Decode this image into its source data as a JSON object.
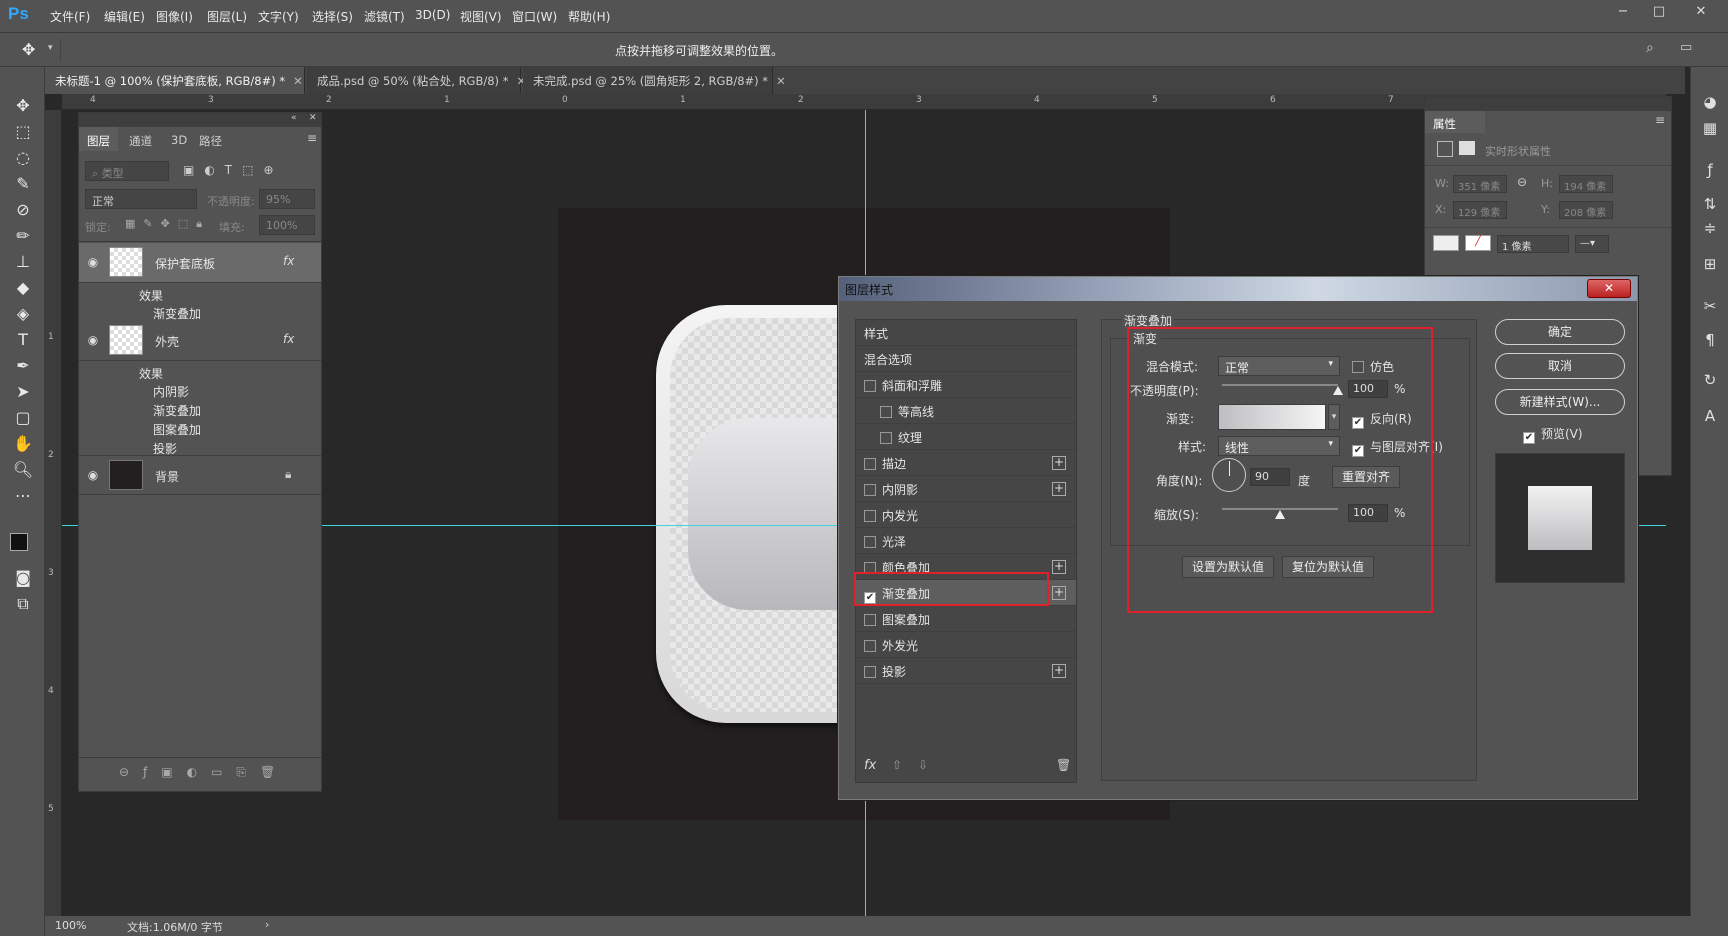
{
  "app": {
    "logo": "Ps"
  },
  "menu": [
    "文件(F)",
    "编辑(E)",
    "图像(I)",
    "图层(L)",
    "文字(Y)",
    "选择(S)",
    "滤镜(T)",
    "3D(D)",
    "视图(V)",
    "窗口(W)",
    "帮助(H)"
  ],
  "window_controls": {
    "minimize": "−",
    "maximize": "□",
    "close": "✕"
  },
  "options_bar": {
    "hint": "点按并拖移可调整效果的位置。"
  },
  "doc_tabs": [
    {
      "label": "未标题-1 @ 100% (保护套底板, RGB/8#) *",
      "active": true
    },
    {
      "label": "成品.psd @ 50% (粘合处, RGB/8) *",
      "active": false
    },
    {
      "label": "未完成.psd @ 25% (圆角矩形 2, RGB/8#) *",
      "active": false
    }
  ],
  "tab_close": "✕",
  "ruler_h_labels": [
    "4",
    "3",
    "2",
    "1",
    "0",
    "1",
    "2",
    "3",
    "4",
    "5",
    "6",
    "7"
  ],
  "ruler_v_labels": [
    "1",
    "2",
    "3",
    "4",
    "5"
  ],
  "layers_panel": {
    "tabs": [
      "图层",
      "通道",
      "3D",
      "路径"
    ],
    "filter_placeholder": "类型",
    "blend_mode": "正常",
    "opacity_label": "不透明度:",
    "opacity_value": "95%",
    "lock_label": "锁定:",
    "fill_label": "填充:",
    "fill_value": "100%",
    "layers": [
      {
        "name": "保护套底板",
        "fx": "fx",
        "effects_label": "效果",
        "effects": [
          "渐变叠加"
        ]
      },
      {
        "name": "外壳",
        "fx": "fx",
        "effects_label": "效果",
        "effects": [
          "内阴影",
          "渐变叠加",
          "图案叠加",
          "投影"
        ]
      },
      {
        "name": "背景"
      }
    ]
  },
  "properties_panel": {
    "title": "属性",
    "subtitle": "实时形状属性",
    "w_label": "W:",
    "w_value": "351 像素",
    "h_label": "H:",
    "h_value": "194 像素",
    "x_label": "X:",
    "x_value": "129 像素",
    "y_label": "Y:",
    "y_value": "208 像素",
    "stroke_width": "1 像素"
  },
  "status_bar": {
    "zoom": "100%",
    "doc_info": "文档:1.06M/0 字节"
  },
  "dialog": {
    "title": "图层样式",
    "close": "✕",
    "style_list": [
      {
        "label": "样式",
        "checkbox": false,
        "checked": false,
        "plus": false,
        "indent": false
      },
      {
        "label": "混合选项",
        "checkbox": false,
        "checked": false,
        "plus": false,
        "indent": false
      },
      {
        "label": "斜面和浮雕",
        "checkbox": true,
        "checked": false,
        "plus": false,
        "indent": false
      },
      {
        "label": "等高线",
        "checkbox": true,
        "checked": false,
        "plus": false,
        "indent": true
      },
      {
        "label": "纹理",
        "checkbox": true,
        "checked": false,
        "plus": false,
        "indent": true
      },
      {
        "label": "描边",
        "checkbox": true,
        "checked": false,
        "plus": true,
        "indent": false
      },
      {
        "label": "内阴影",
        "checkbox": true,
        "checked": false,
        "plus": true,
        "indent": false
      },
      {
        "label": "内发光",
        "checkbox": true,
        "checked": false,
        "plus": false,
        "indent": false
      },
      {
        "label": "光泽",
        "checkbox": true,
        "checked": false,
        "plus": false,
        "indent": false
      },
      {
        "label": "颜色叠加",
        "checkbox": true,
        "checked": false,
        "plus": true,
        "indent": false
      },
      {
        "label": "渐变叠加",
        "checkbox": true,
        "checked": true,
        "plus": true,
        "indent": false
      },
      {
        "label": "图案叠加",
        "checkbox": true,
        "checked": false,
        "plus": false,
        "indent": false
      },
      {
        "label": "外发光",
        "checkbox": true,
        "checked": false,
        "plus": false,
        "indent": false
      },
      {
        "label": "投影",
        "checkbox": true,
        "checked": false,
        "plus": true,
        "indent": false
      }
    ],
    "section_title": "渐变叠加",
    "group_title": "渐变",
    "blend_mode_label": "混合模式:",
    "blend_mode_value": "正常",
    "dither_label": "仿色",
    "opacity_label": "不透明度(P):",
    "opacity_value": "100",
    "opacity_fraction": 1.0,
    "percent": "%",
    "gradient_label": "渐变:",
    "reverse_label": "反向(R)",
    "style_label": "样式:",
    "style_value": "线性",
    "align_label": "与图层对齐(I)",
    "angle_label": "角度(N):",
    "angle_value": "90",
    "degree": "度",
    "reset_align": "重置对齐",
    "scale_label": "缩放(S):",
    "scale_value": "100",
    "scale_fraction": 0.5,
    "set_default": "设置为默认值",
    "reset_default": "复位为默认值",
    "ok": "确定",
    "cancel": "取消",
    "new_style": "新建样式(W)...",
    "preview_label": "预览(V)",
    "footer_fx": "fx"
  }
}
